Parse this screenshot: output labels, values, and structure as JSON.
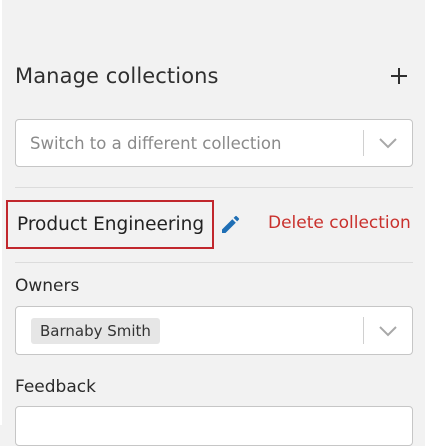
{
  "header": {
    "title": "Manage collections",
    "add_icon": "plus-icon"
  },
  "switcher": {
    "placeholder": "Switch to a different collection",
    "icon": "chevron-down-icon"
  },
  "collection": {
    "name": "Product Engineering",
    "edit_icon": "pencil-icon",
    "delete_label": "Delete collection"
  },
  "owners": {
    "label": "Owners",
    "selected": [
      "Barnaby Smith"
    ],
    "icon": "chevron-down-icon"
  },
  "feedback": {
    "label": "Feedback",
    "value": ""
  },
  "colors": {
    "background": "#f2f2f2",
    "delete_red": "#c9302c",
    "highlight_border": "#c1272d",
    "edit_blue": "#1f6fb5"
  }
}
